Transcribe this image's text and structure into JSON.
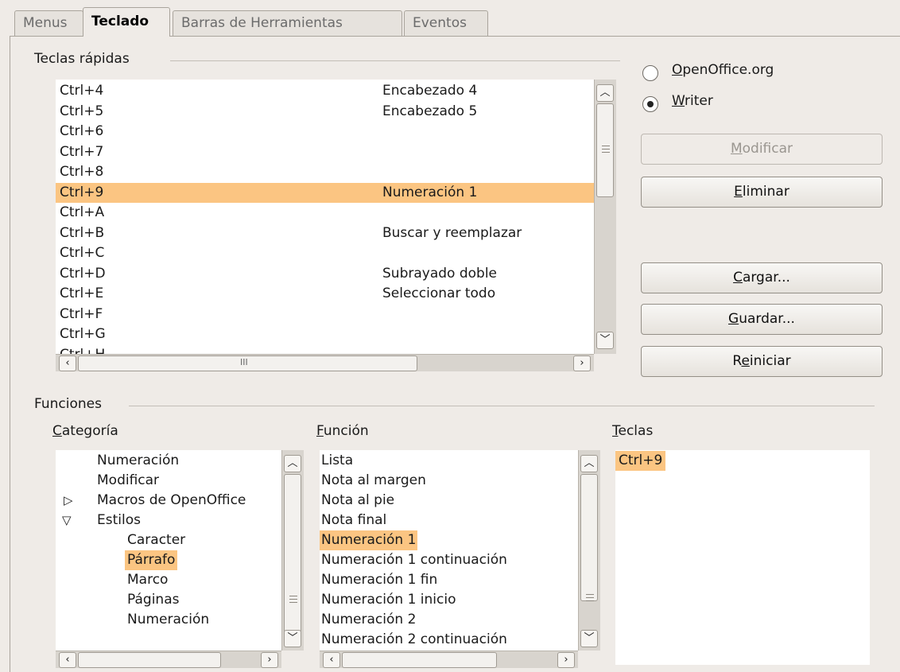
{
  "tabs": [
    "Menus",
    "Teclado",
    "Barras de Herramientas",
    "Eventos"
  ],
  "shortcuts": {
    "label": "Teclas rápidas",
    "rows": [
      {
        "key": "Ctrl+4",
        "func": "Encabezado 4"
      },
      {
        "key": "Ctrl+5",
        "func": "Encabezado 5"
      },
      {
        "key": "Ctrl+6",
        "func": ""
      },
      {
        "key": "Ctrl+7",
        "func": ""
      },
      {
        "key": "Ctrl+8",
        "func": ""
      },
      {
        "key": "Ctrl+9",
        "func": "Numeración 1"
      },
      {
        "key": "Ctrl+A",
        "func": ""
      },
      {
        "key": "Ctrl+B",
        "func": "Buscar y reemplazar"
      },
      {
        "key": "Ctrl+C",
        "func": ""
      },
      {
        "key": "Ctrl+D",
        "func": "Subrayado doble"
      },
      {
        "key": "Ctrl+E",
        "func": "Seleccionar todo"
      },
      {
        "key": "Ctrl+F",
        "func": ""
      },
      {
        "key": "Ctrl+G",
        "func": ""
      },
      {
        "key": "Ctrl+H",
        "func": ""
      }
    ],
    "selected_index": 5
  },
  "scope": {
    "openoffice": {
      "pre": "",
      "mn": "O",
      "post": "penOffice.org"
    },
    "writer": {
      "pre": "",
      "mn": "W",
      "post": "riter"
    },
    "selected": "writer"
  },
  "buttons": {
    "modificar": {
      "pre": "",
      "mn": "M",
      "post": "odificar"
    },
    "eliminar": {
      "pre": "",
      "mn": "E",
      "post": "liminar"
    },
    "cargar": {
      "pre": "",
      "mn": "C",
      "post": "argar..."
    },
    "guardar": {
      "pre": "",
      "mn": "G",
      "post": "uardar..."
    },
    "reiniciar": {
      "pre": "R",
      "mn": "e",
      "post": "iniciar"
    }
  },
  "functions": {
    "label": "Funciones",
    "categoria": {
      "pre": "",
      "mn": "C",
      "post": "ategoría"
    },
    "funcion": {
      "pre": "",
      "mn": "F",
      "post": "unción"
    },
    "teclas": {
      "pre": "",
      "mn": "T",
      "post": "eclas"
    },
    "categories": [
      {
        "label": "Numeración"
      },
      {
        "label": "Modificar"
      },
      {
        "label": "Macros de OpenOffice"
      },
      {
        "label": "Estilos"
      },
      {
        "label": "Caracter"
      },
      {
        "label": "Párrafo"
      },
      {
        "label": "Marco"
      },
      {
        "label": "Páginas"
      },
      {
        "label": "Numeración"
      }
    ],
    "function_list": [
      "Lista",
      "Nota al margen",
      "Nota al pie",
      "Nota final",
      "Numeración 1",
      "Numeración 1 continuación",
      "Numeración 1 fin",
      "Numeración 1 inicio",
      "Numeración 2",
      "Numeración 2 continuación"
    ],
    "keys": [
      "Ctrl+9"
    ]
  }
}
